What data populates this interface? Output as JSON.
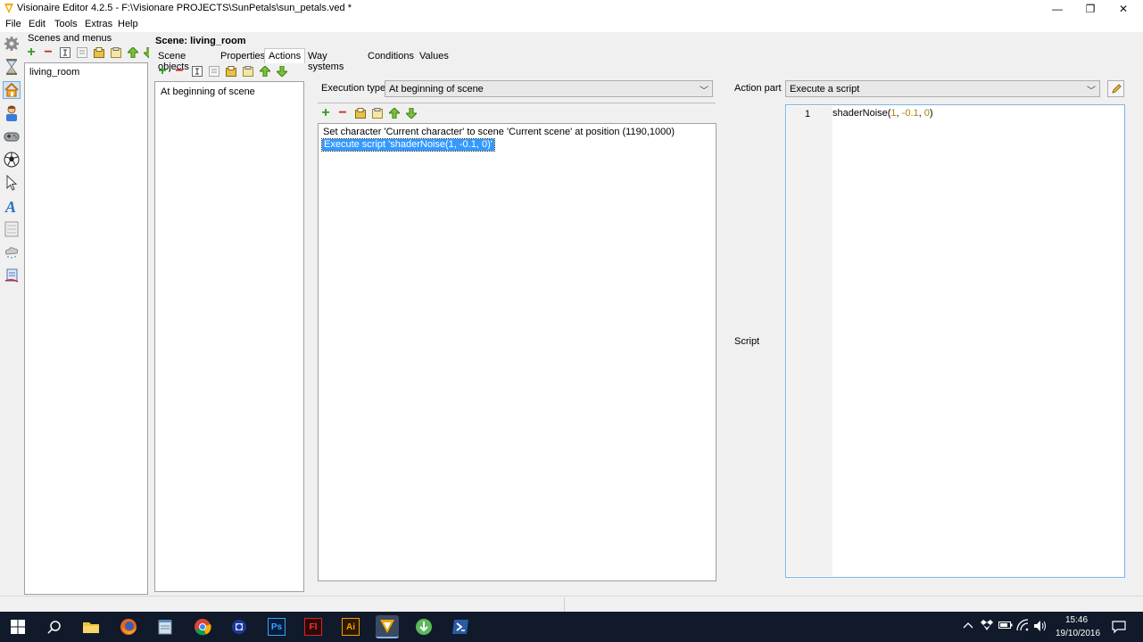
{
  "window": {
    "title": "Visionaire Editor 4.2.5 - F:\\Visionare PROJECTS\\SunPetals\\sun_petals.ved *",
    "minimize_glyph": "—",
    "restore_glyph": "❐",
    "close_glyph": "✕"
  },
  "menu": [
    "File",
    "Edit",
    "Tools",
    "Extras",
    "Help"
  ],
  "sidebar": {
    "title": "Scenes and menus",
    "icons": [
      "settings-icon",
      "hourglass-icon",
      "scene-house-icon",
      "character-icon",
      "gamepad-icon",
      "ball-icon",
      "cursor-icon",
      "font-icon",
      "interface-icon",
      "particles-icon",
      "script-scroll-icon"
    ],
    "tree_items": [
      "living_room"
    ]
  },
  "scene": {
    "header": "Scene: living_room",
    "tabs": [
      "Scene objects",
      "Properties",
      "Actions",
      "Way systems",
      "Conditions",
      "Values"
    ],
    "active_tab": "Actions"
  },
  "actions": {
    "items": [
      "At beginning of scene"
    ]
  },
  "execution": {
    "label": "Execution type",
    "value": "At beginning of scene",
    "parts": [
      "Set character 'Current character' to scene 'Current scene' at position (1190,1000)",
      "Execute script 'shaderNoise(1, -0.1, 0)'"
    ],
    "selected_part": 1
  },
  "action_part": {
    "label": "Action part",
    "value": "Execute a script",
    "script_label": "Script",
    "line_number": "1",
    "code_fn": "shaderNoise(",
    "code_args": [
      "1",
      ", ",
      "-0.1",
      ", ",
      "0"
    ],
    "code_close": ")"
  },
  "taskbar": {
    "apps": [
      "windows-start-icon",
      "search-icon",
      "file-explorer-icon",
      "firefox-icon",
      "notepad-icon",
      "chrome-icon",
      "app-icon",
      "photoshop-icon",
      "flash-icon",
      "illustrator-icon",
      "visionaire-icon",
      "torrent-icon",
      "powershell-icon"
    ],
    "ps_label": "Ps",
    "fl_label": "Fl",
    "ai_label": "Ai",
    "time": "15:46",
    "date": "19/10/2016"
  },
  "colors": {
    "selection": "#3399ff",
    "add_green": "#2e9e1f",
    "remove_red": "#d22020",
    "taskbar": "#101a2a"
  }
}
